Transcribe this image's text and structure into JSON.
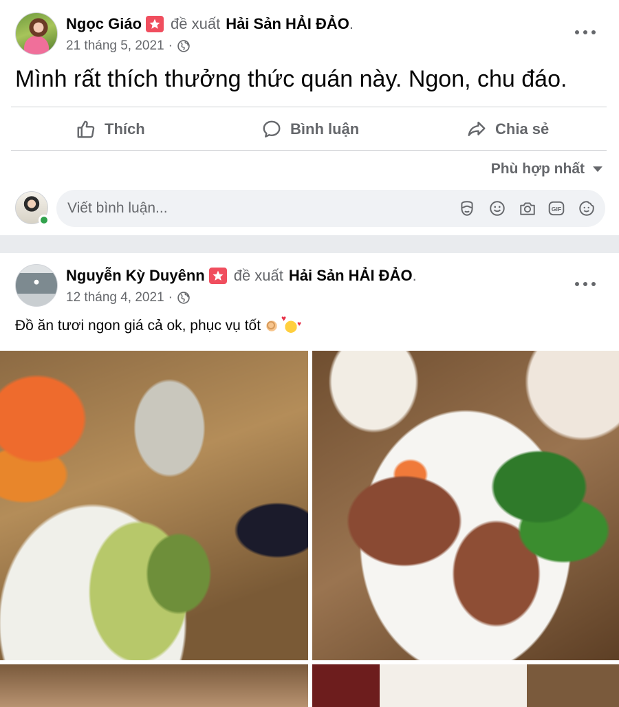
{
  "posts": [
    {
      "author": "Ngọc Giáo",
      "verb": "đề xuất",
      "page": "Hải Sản HẢI ĐẢO",
      "date": "21 tháng 5, 2021",
      "text": "Mình rất thích thưởng thức quán này. Ngon, chu đáo.",
      "actions": {
        "like": "Thích",
        "comment": "Bình luận",
        "share": "Chia sẻ"
      },
      "sort_label": "Phù hợp nhất",
      "comment_placeholder": "Viết bình luận..."
    },
    {
      "author": "Nguyễn Kỳ Duyênn",
      "verb": "đề xuất",
      "page": "Hải Sản HẢI ĐẢO",
      "date": "12 tháng 4, 2021",
      "text": "Đồ ăn tươi ngon giá cả ok, phục vụ tốt"
    }
  ],
  "punctuation": {
    "period": ".",
    "date_sep": "·"
  },
  "icons": {
    "badge": "recommend-star-icon",
    "privacy": "globe-icon",
    "more": "more-options-icon",
    "like": "thumbs-up-icon",
    "comment": "comment-bubble-icon",
    "share": "share-arrow-icon",
    "sort": "caret-down-icon",
    "comment_tools": [
      "avatar-sticker-icon",
      "emoji-icon",
      "camera-icon",
      "gif-icon",
      "sticker-icon"
    ],
    "emoji": [
      "ok-hand-emoji",
      "smiling-face-hearts-emoji"
    ]
  },
  "colors": {
    "recommend_badge": "#f04e5e",
    "online": "#31a24c",
    "secondary_text": "#65676b"
  }
}
